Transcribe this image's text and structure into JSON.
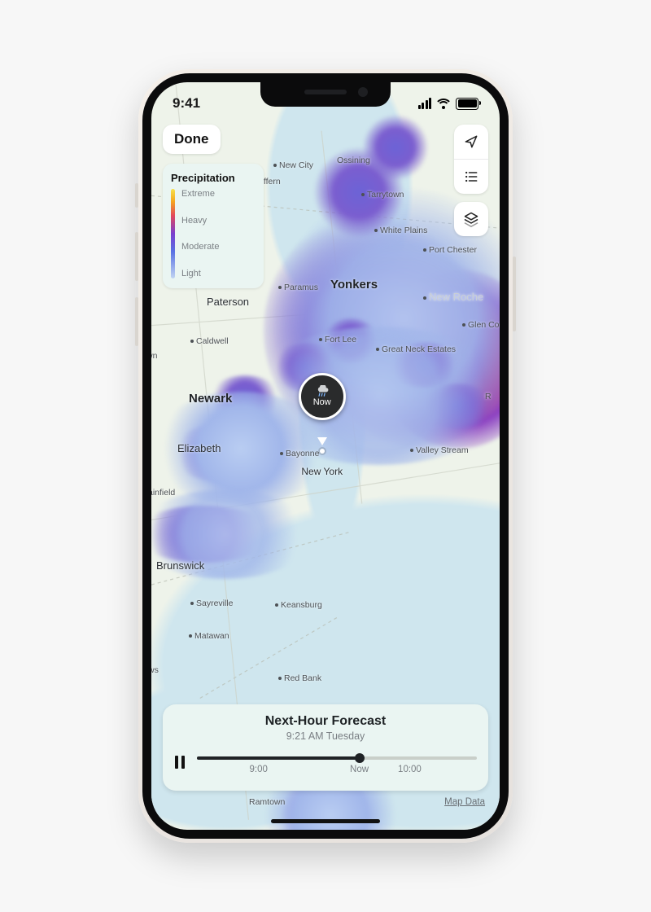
{
  "status": {
    "time": "9:41"
  },
  "toolbar": {
    "done_label": "Done",
    "locate_icon": "location-arrow-icon",
    "list_icon": "list-icon",
    "layers_icon": "layers-icon"
  },
  "legend": {
    "title": "Precipitation",
    "levels": {
      "l0": "Extreme",
      "l1": "Heavy",
      "l2": "Moderate",
      "l3": "Light"
    }
  },
  "pin": {
    "label": "Now",
    "city": "New York"
  },
  "forecast": {
    "title": "Next-Hour Forecast",
    "subtitle": "9:21 AM Tuesday",
    "play_state": "pause",
    "timeline": {
      "labels": {
        "start": "9:00",
        "now": "Now",
        "next": "10:00"
      },
      "start_pct": 22,
      "now_pct": 58,
      "next_pct": 76,
      "progress_pct": 58
    }
  },
  "footer": {
    "map_data_label": "Map Data"
  },
  "map_labels": {
    "newcity": "New City",
    "ossining": "Ossining",
    "suffern": "Suffern",
    "tarrytown": "Tarrytown",
    "whiteplains": "White Plains",
    "portchester": "Port Chester",
    "yonkers": "Yonkers",
    "paramus": "Paramus",
    "paterson": "Paterson",
    "fortlee": "Fort Lee",
    "greatneck": "Great Neck Estates",
    "glencove": "Glen Cov",
    "newroch": "New Roche",
    "caldwell": "Caldwell",
    "newark": "Newark",
    "elizabeth": "Elizabeth",
    "bayonne": "Bayonne",
    "valleystream": "Valley Stream",
    "plainfield": "ainfield",
    "brunswick": "Brunswick",
    "sayreville": "Sayreville",
    "matawan": "Matawan",
    "keansburg": "Keansburg",
    "redbank": "Red Bank",
    "town": "wn",
    "ws": "ws",
    "r": "R",
    "ramtown": "Ramtown"
  }
}
